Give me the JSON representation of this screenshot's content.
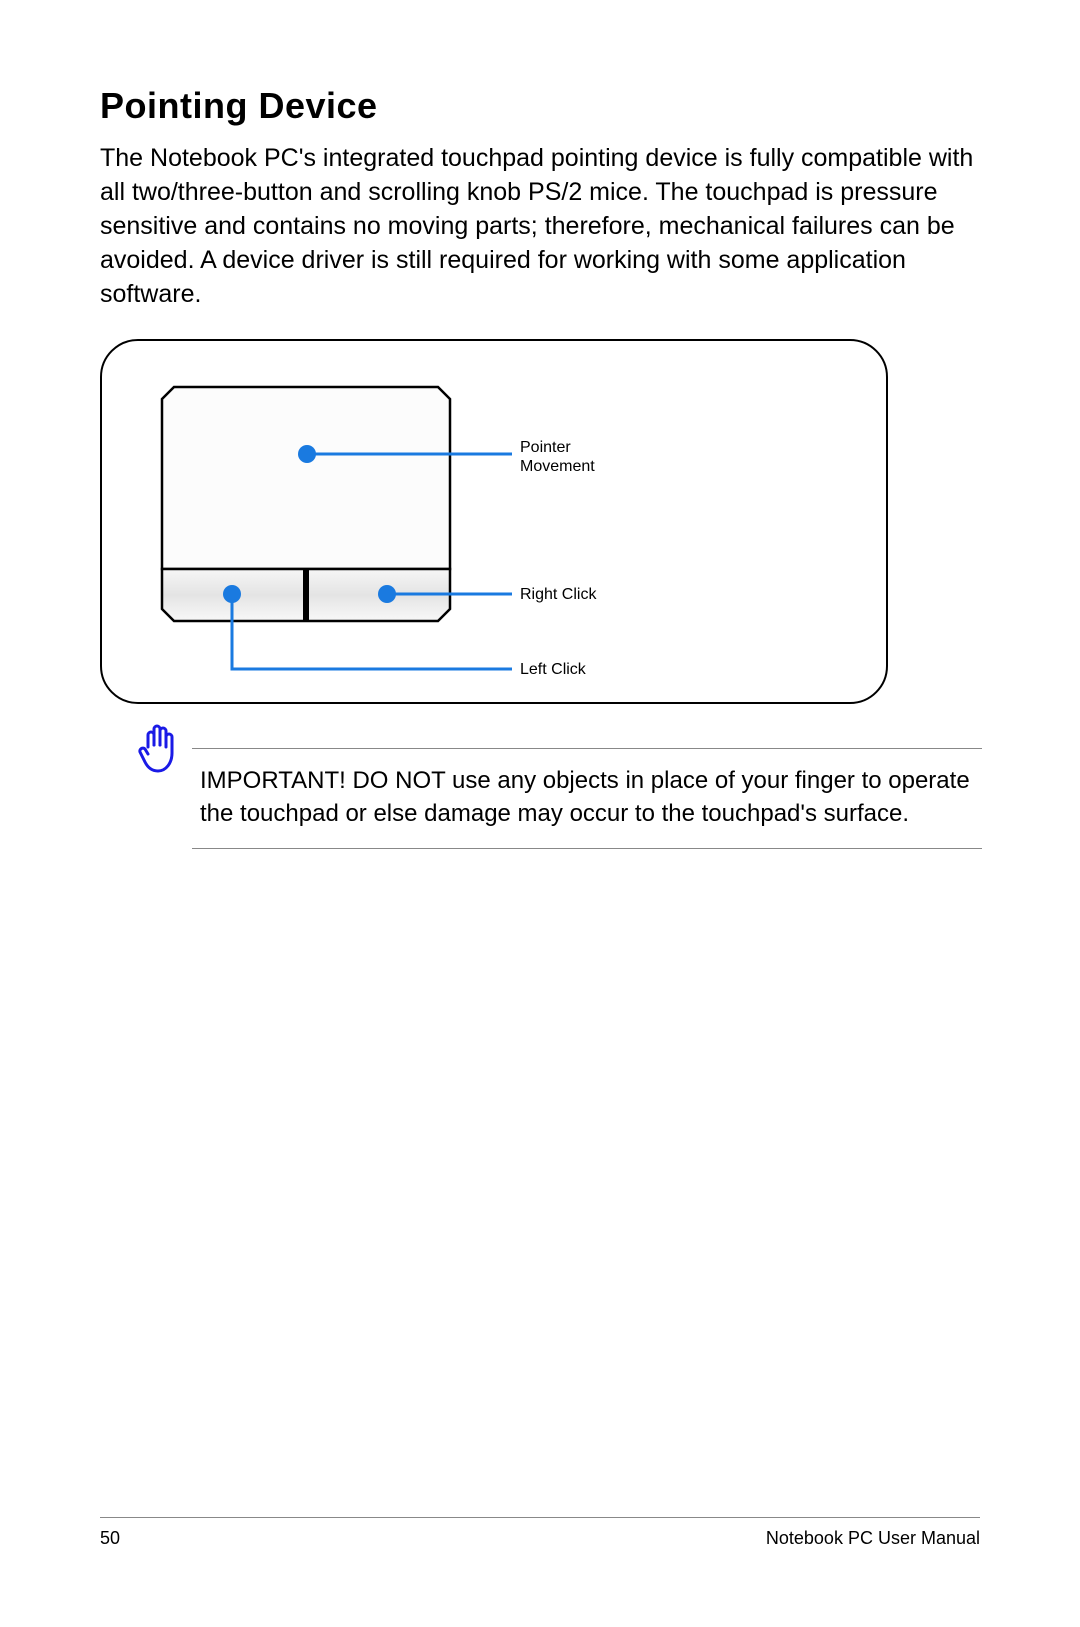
{
  "title": "Pointing Device",
  "body": "The Notebook PC's integrated touchpad pointing device is fully compatible with all two/three-button and scrolling knob PS/2 mice. The touchpad is pressure sensitive and contains no moving parts; therefore, mechanical failures can be avoided. A device driver is still required for working with some application software.",
  "diagram": {
    "labels": {
      "pointer_movement_line1": "Pointer",
      "pointer_movement_line2": "Movement",
      "right_click": "Right Click",
      "left_click": "Left Click"
    }
  },
  "callout": {
    "text": "IMPORTANT! DO NOT use any objects in place of your finger to operate the touchpad or else damage may occur to the touchpad's surface."
  },
  "footer": {
    "page_number": "50",
    "manual_title": "Notebook PC User Manual"
  }
}
